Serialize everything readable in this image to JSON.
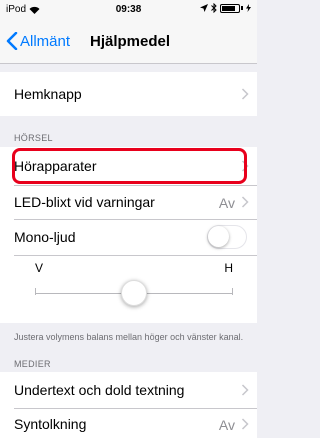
{
  "status_bar": {
    "device": "iPod",
    "time": "09:38",
    "wifi_icon": "wifi-icon",
    "bluetooth_icon": "bluetooth-icon",
    "battery_level": 0.8
  },
  "nav": {
    "back_label": "Allmänt",
    "title": "Hjälpmedel"
  },
  "rows": {
    "hemknapp": "Hemknapp",
    "horapparater": "Hörapparater",
    "led": "LED-blixt vid varningar",
    "led_value": "Av",
    "mono": "Mono-ljud",
    "mono_switch_on": false,
    "undertext": "Undertext och dold textning",
    "syntolkning": "Syntolkning",
    "syntolkning_value": "Av"
  },
  "sections": {
    "horsel": "HÖRSEL",
    "medier": "MEDIER"
  },
  "balance": {
    "left_label": "V",
    "right_label": "H",
    "value": 0.5,
    "footer": "Justera volymens balans mellan höger och vänster kanal."
  },
  "colors": {
    "accent": "#007aff",
    "highlight": "#e8001c"
  }
}
